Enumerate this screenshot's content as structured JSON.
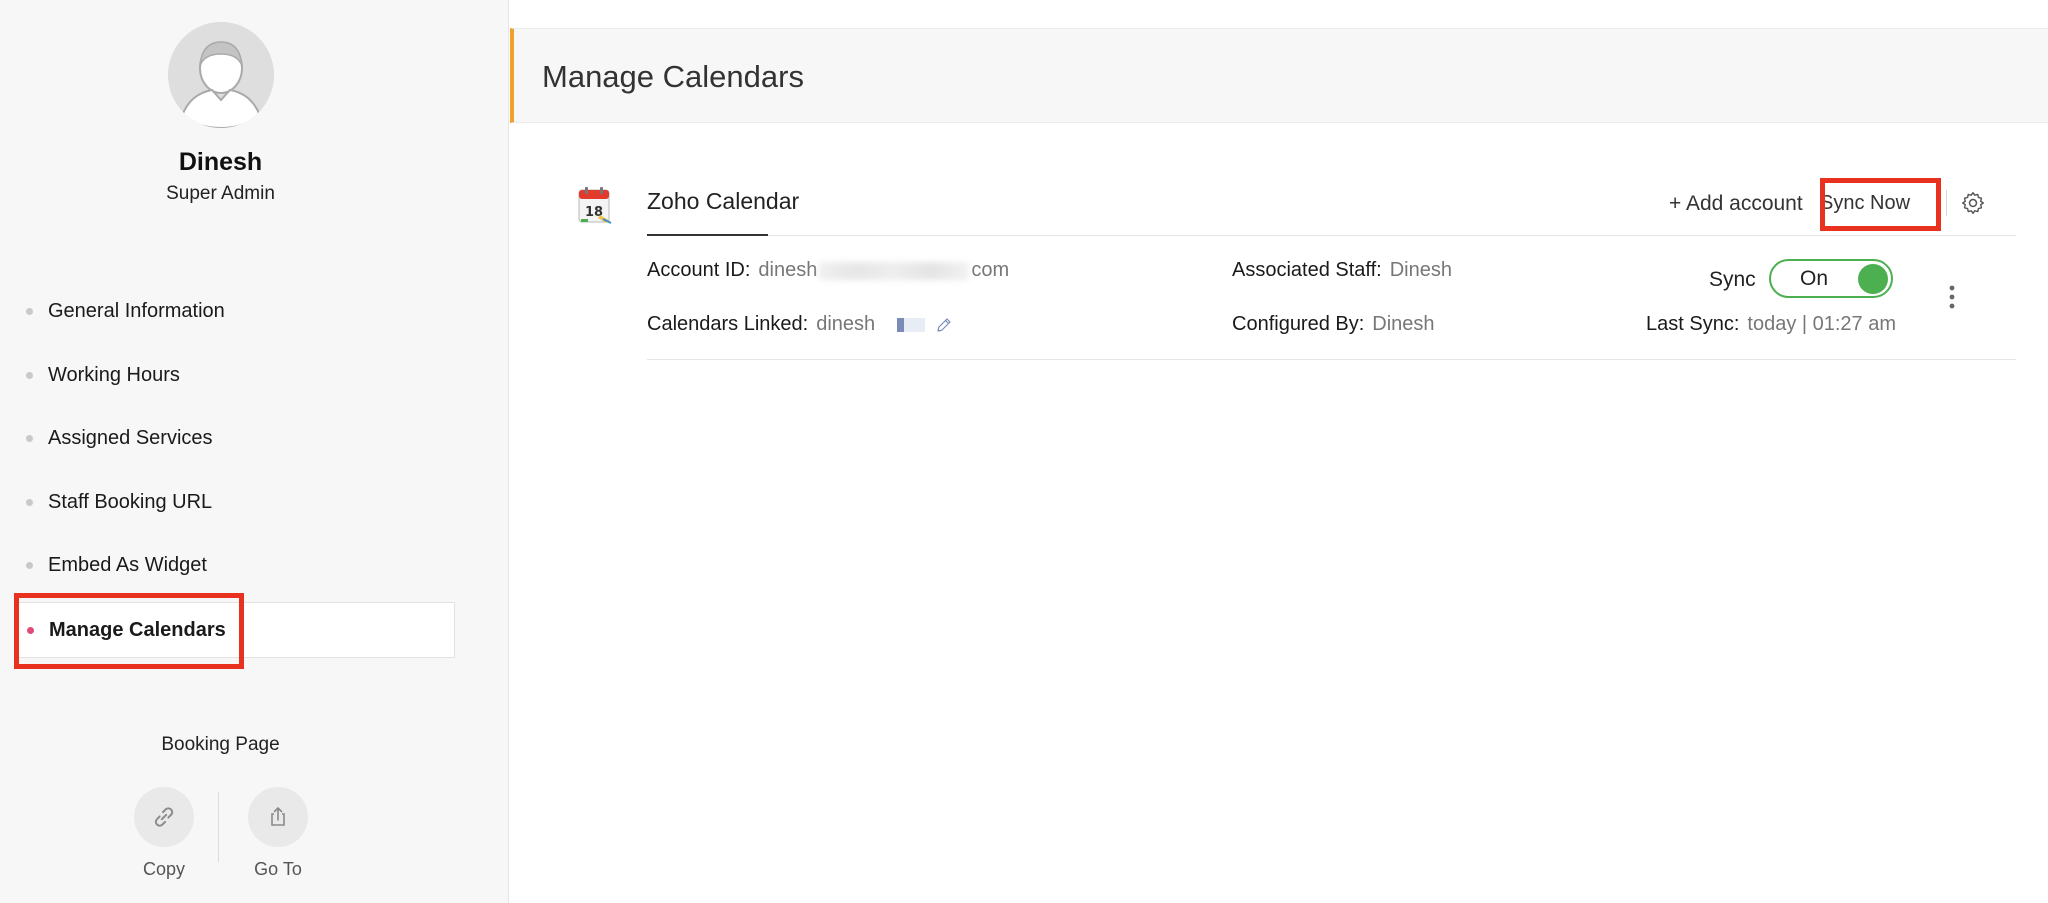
{
  "profile": {
    "name": "Dinesh",
    "role": "Super Admin"
  },
  "sidebar": {
    "items": [
      {
        "label": "General Information",
        "active": false
      },
      {
        "label": "Working Hours",
        "active": false
      },
      {
        "label": "Assigned Services",
        "active": false
      },
      {
        "label": "Staff Booking URL",
        "active": false
      },
      {
        "label": "Embed As Widget",
        "active": false
      },
      {
        "label": "Manage Calendars",
        "active": true
      }
    ]
  },
  "booking_page": {
    "title": "Booking Page",
    "copy_label": "Copy",
    "goto_label": "Go To"
  },
  "main": {
    "title": "Manage Calendars",
    "calendar": {
      "name": "Zoho Calendar",
      "add_account_label": "+ Add account",
      "sync_now_label": "Sync Now",
      "account_id_label": "Account ID:",
      "account_id_prefix": "dinesh",
      "account_id_suffix": "com",
      "calendars_linked_label": "Calendars Linked:",
      "calendars_linked_value": "dinesh",
      "associated_staff_label": "Associated Staff:",
      "associated_staff_value": "Dinesh",
      "configured_by_label": "Configured By:",
      "configured_by_value": "Dinesh",
      "sync_label": "Sync",
      "sync_toggle_value": "On",
      "last_sync_label": "Last Sync:",
      "last_sync_value": "today | 01:27 am"
    }
  },
  "icons": {
    "avatar": "user-avatar-icon",
    "calendar_logo": "calendar-app-icon",
    "gear": "gear-icon",
    "kebab": "more-vertical-icon",
    "pencil": "edit-pencil-icon",
    "link": "link-icon",
    "share": "share-icon"
  },
  "colors": {
    "accent_orange": "#f0a030",
    "active_bullet": "#e04a77",
    "toggle_green": "#4caf50",
    "highlight_red": "#e8321f"
  }
}
